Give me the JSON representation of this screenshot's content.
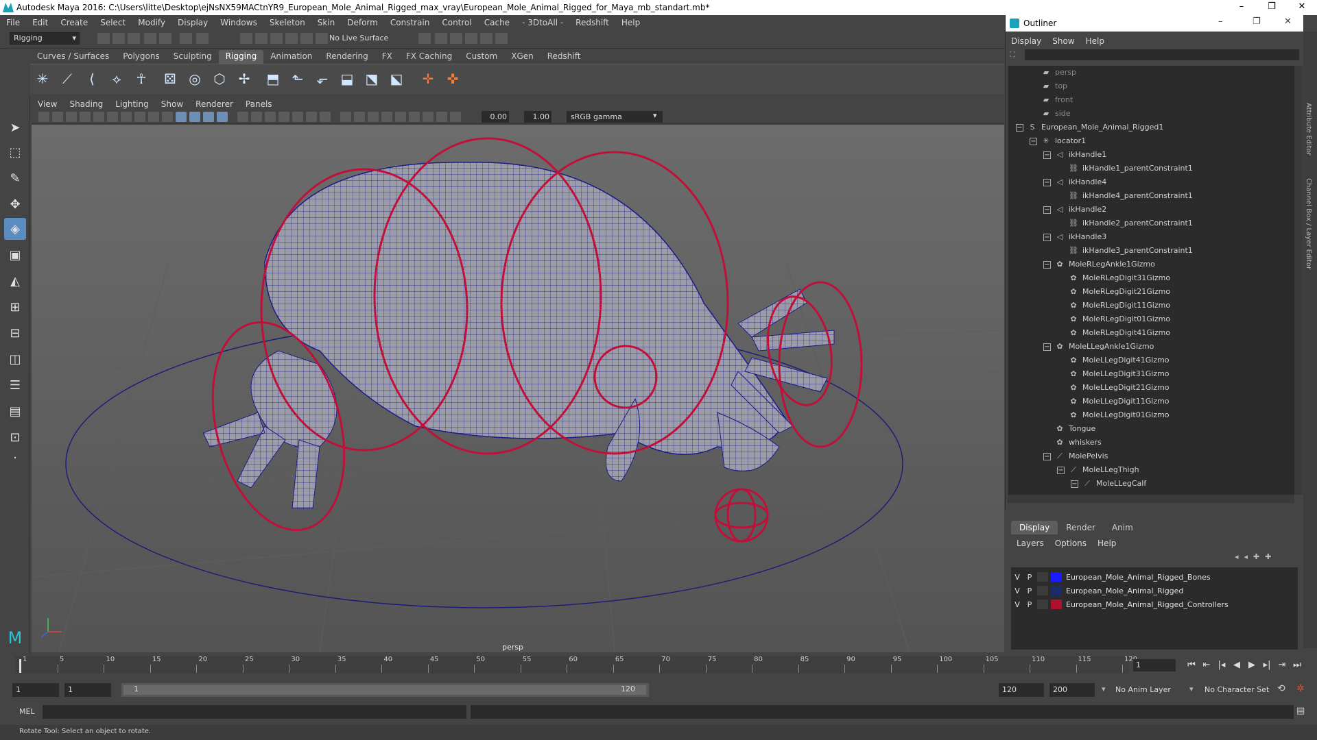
{
  "window": {
    "title": "Autodesk Maya 2016: C:\\Users\\litte\\Desktop\\ejNsNX59MACtnYR9_European_Mole_Animal_Rigged_max_vray\\European_Mole_Animal_Rigged_for_Maya_mb_standart.mb*",
    "controls": [
      "–",
      "❐",
      "✕"
    ]
  },
  "menubar": [
    "File",
    "Edit",
    "Create",
    "Select",
    "Modify",
    "Display",
    "Windows",
    "Skeleton",
    "Skin",
    "Deform",
    "Constrain",
    "Control",
    "Cache",
    "- 3DtoAll -",
    "Redshift",
    "Help"
  ],
  "statusline": {
    "mode": "Rigging",
    "live_surface": "No Live Surface"
  },
  "shelf": {
    "tabs": [
      "Curves / Surfaces",
      "Polygons",
      "Sculpting",
      "Rigging",
      "Animation",
      "Rendering",
      "FX",
      "FX Caching",
      "Custom",
      "XGen",
      "Redshift"
    ],
    "active_tab": "Rigging",
    "icons": [
      "joint-icon",
      "ik-handle-icon",
      "ik-spline-icon",
      "insert-joint-icon",
      "humanik-icon",
      "bind-skin-icon",
      "paint-weights-icon",
      "lattice-icon",
      "cluster-icon",
      "parent-constraint-icon",
      "point-constraint-icon",
      "orient-constraint-icon",
      "scale-constraint-icon",
      "aim-constraint-icon",
      "pole-constraint-icon",
      "locator-icon",
      "edit-locator-icon"
    ]
  },
  "panel": {
    "menus": [
      "View",
      "Shading",
      "Lighting",
      "Show",
      "Renderer",
      "Panels"
    ],
    "exposure": "0.00",
    "gamma": "1.00",
    "color_space": "sRGB gamma",
    "camera": "persp"
  },
  "outliner": {
    "title": "Outliner",
    "menus": [
      "Display",
      "Show",
      "Help"
    ],
    "items": [
      {
        "label": "persp",
        "depth": 2,
        "dim": true,
        "icon": "camera-icon"
      },
      {
        "label": "top",
        "depth": 2,
        "dim": true,
        "icon": "camera-icon"
      },
      {
        "label": "front",
        "depth": 2,
        "dim": true,
        "icon": "camera-icon"
      },
      {
        "label": "side",
        "depth": 2,
        "dim": true,
        "icon": "camera-icon"
      },
      {
        "label": "European_Mole_Animal_Rigged1",
        "depth": 1,
        "expander": "−",
        "icon": "transform-icon"
      },
      {
        "label": "locator1",
        "depth": 2,
        "expander": "−",
        "icon": "locator-icon"
      },
      {
        "label": "ikHandle1",
        "depth": 3,
        "expander": "−",
        "icon": "ik-handle-icon"
      },
      {
        "label": "ikHandle1_parentConstraint1",
        "depth": 4,
        "icon": "constraint-icon"
      },
      {
        "label": "ikHandle4",
        "depth": 3,
        "expander": "−",
        "icon": "ik-handle-icon"
      },
      {
        "label": "ikHandle4_parentConstraint1",
        "depth": 4,
        "icon": "constraint-icon"
      },
      {
        "label": "ikHandle2",
        "depth": 3,
        "expander": "−",
        "icon": "ik-handle-icon"
      },
      {
        "label": "ikHandle2_parentConstraint1",
        "depth": 4,
        "icon": "constraint-icon"
      },
      {
        "label": "ikHandle3",
        "depth": 3,
        "expander": "−",
        "icon": "ik-handle-icon"
      },
      {
        "label": "ikHandle3_parentConstraint1",
        "depth": 4,
        "icon": "constraint-icon"
      },
      {
        "label": "MoleRLegAnkle1Gizmo",
        "depth": 3,
        "expander": "−",
        "icon": "curve-icon"
      },
      {
        "label": "MoleRLegDigit31Gizmo",
        "depth": 4,
        "icon": "curve-icon"
      },
      {
        "label": "MoleRLegDigit21Gizmo",
        "depth": 4,
        "icon": "curve-icon"
      },
      {
        "label": "MoleRLegDigit11Gizmo",
        "depth": 4,
        "icon": "curve-icon"
      },
      {
        "label": "MoleRLegDigit01Gizmo",
        "depth": 4,
        "icon": "curve-icon"
      },
      {
        "label": "MoleRLegDigit41Gizmo",
        "depth": 4,
        "icon": "curve-icon"
      },
      {
        "label": "MoleLLegAnkle1Gizmo",
        "depth": 3,
        "expander": "−",
        "icon": "curve-icon"
      },
      {
        "label": "MoleLLegDigit41Gizmo",
        "depth": 4,
        "icon": "curve-icon"
      },
      {
        "label": "MoleLLegDigit31Gizmo",
        "depth": 4,
        "icon": "curve-icon"
      },
      {
        "label": "MoleLLegDigit21Gizmo",
        "depth": 4,
        "icon": "curve-icon"
      },
      {
        "label": "MoleLLegDigit11Gizmo",
        "depth": 4,
        "icon": "curve-icon"
      },
      {
        "label": "MoleLLegDigit01Gizmo",
        "depth": 4,
        "icon": "curve-icon"
      },
      {
        "label": "Tongue",
        "depth": 3,
        "icon": "curve-icon"
      },
      {
        "label": "whiskers",
        "depth": 3,
        "icon": "curve-icon"
      },
      {
        "label": "MolePelvis",
        "depth": 3,
        "expander": "−",
        "icon": "joint-icon"
      },
      {
        "label": "MoleLLegThigh",
        "depth": 4,
        "expander": "−",
        "icon": "joint-icon"
      },
      {
        "label": "MoleLLegCalf",
        "depth": 5,
        "expander": "−",
        "icon": "joint-icon"
      }
    ]
  },
  "side_tabs": [
    "Attribute Editor",
    "Channel Box / Layer Editor"
  ],
  "layer_editor": {
    "tabs": [
      "Display",
      "Render",
      "Anim"
    ],
    "active_tab": "Display",
    "menus": [
      "Layers",
      "Options",
      "Help"
    ],
    "layers": [
      {
        "v": "V",
        "p": "P",
        "color": "#1a1aff",
        "name": "European_Mole_Animal_Rigged_Bones"
      },
      {
        "v": "V",
        "p": "P",
        "color": "#1a2a6a",
        "name": "European_Mole_Animal_Rigged"
      },
      {
        "v": "V",
        "p": "P",
        "color": "#b01030",
        "name": "European_Mole_Animal_Rigged_Controllers"
      }
    ]
  },
  "timeline": {
    "ticks": [
      "1",
      "5",
      "10",
      "15",
      "20",
      "25",
      "30",
      "35",
      "40",
      "45",
      "50",
      "55",
      "60",
      "65",
      "70",
      "75",
      "80",
      "85",
      "90",
      "95",
      "100",
      "105",
      "110",
      "115",
      "120"
    ],
    "current_frame": "1",
    "playback_icons": [
      "go-start-icon",
      "step-back-key-icon",
      "step-back-icon",
      "play-back-icon",
      "play-forward-icon",
      "step-forward-icon",
      "step-forward-key-icon",
      "go-end-icon"
    ]
  },
  "range": {
    "start": "1",
    "playback_start": "1",
    "slider_start": "1",
    "slider_end": "120",
    "playback_end": "120",
    "end": "200",
    "anim_layer": "No Anim Layer",
    "character_set": "No Character Set"
  },
  "command_line": {
    "label": "MEL"
  },
  "help_line": "Rotate Tool: Select an object to rotate.",
  "colors": {
    "viewport_top": "#6c6c6c",
    "wire": "#1a1a9a",
    "controller": "#c0103a",
    "mesh": "#9a9aa6"
  }
}
